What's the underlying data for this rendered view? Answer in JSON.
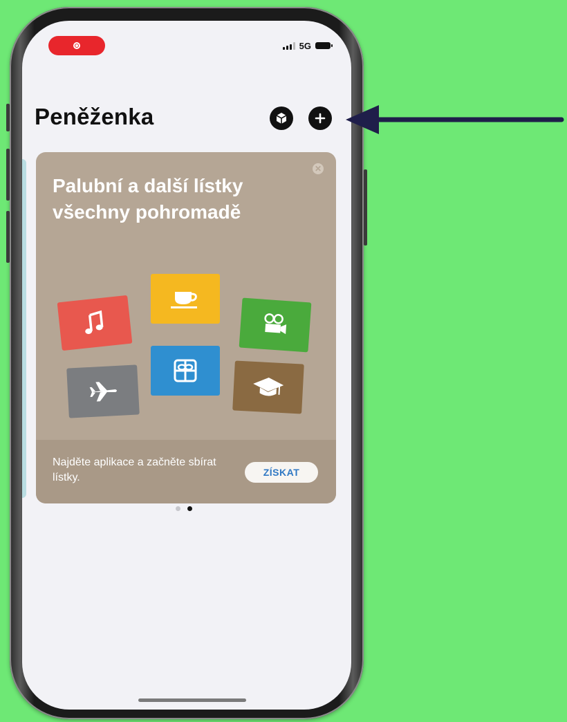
{
  "status_bar": {
    "network": "5G",
    "recording_indicator": "screen-recording-icon"
  },
  "wallet": {
    "title": "Peněženka",
    "scan_icon": "cube-icon",
    "add_icon": "plus-icon"
  },
  "promo_card": {
    "title": "Palubní a další lístky všechny pohromadě",
    "footer_text": "Najděte aplikace a začněte sbírat lístky.",
    "button_label": "ZÍSKAT",
    "close_icon": "close-icon",
    "tickets": [
      {
        "icon": "music-note-icon",
        "color": "#e8584e"
      },
      {
        "icon": "coffee-cup-icon",
        "color": "#f5b820"
      },
      {
        "icon": "movie-camera-icon",
        "color": "#4aaa3c"
      },
      {
        "icon": "airplane-icon",
        "color": "#7b7d80"
      },
      {
        "icon": "gift-icon",
        "color": "#2f8fd0"
      },
      {
        "icon": "graduation-cap-icon",
        "color": "#8a6a42"
      }
    ]
  },
  "page_dots": {
    "count": 2,
    "active_index": 1
  },
  "colors": {
    "background": "#6ee875",
    "card": "#b5a695",
    "arrow": "#1f1e4a"
  }
}
